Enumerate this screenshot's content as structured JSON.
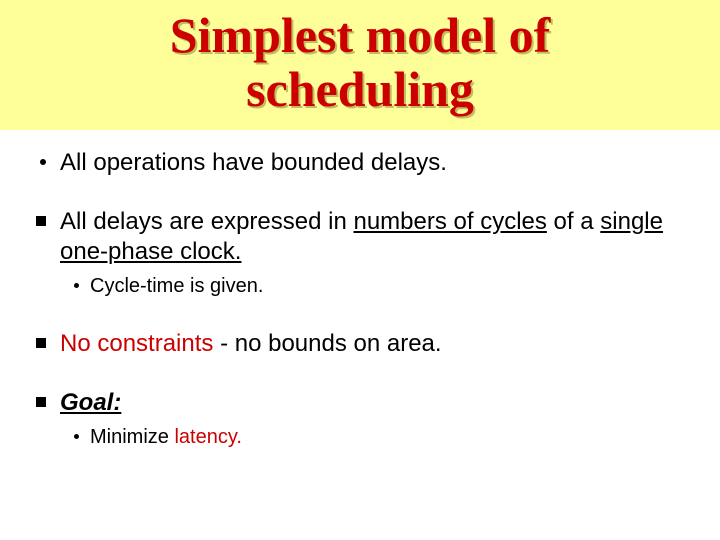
{
  "title_line1": "Simplest model of",
  "title_line2": "scheduling",
  "bullets": {
    "b1": "All operations have bounded delays.",
    "b2_pre": " All delays are expressed in ",
    "b2_ul1": "numbers of cycles",
    "b2_mid": " of a ",
    "b2_ul2": "single one-phase clock.",
    "b2_sub": "Cycle-time is given.",
    "b3_pre": "No constraints",
    "b3_post": " - no bounds on area.",
    "b4": "Goal:",
    "b4_sub_pre": "Minimize ",
    "b4_sub_red": "latency."
  }
}
